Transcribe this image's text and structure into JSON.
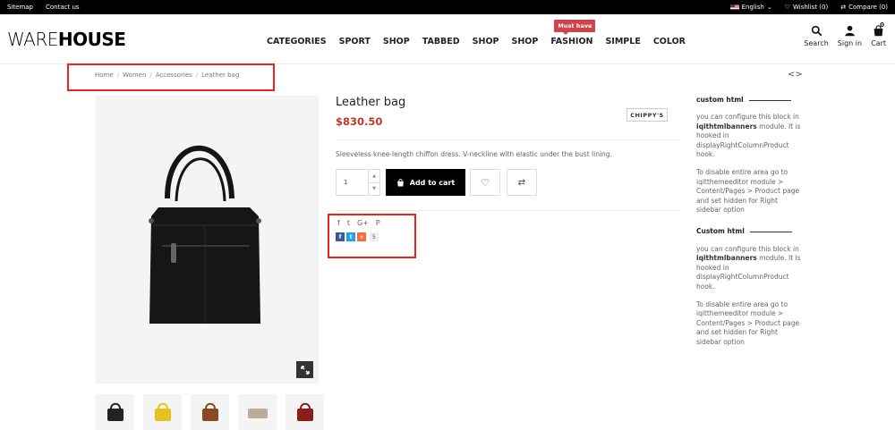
{
  "topbar": {
    "links": [
      "Sitemap",
      "Contact us"
    ],
    "language": "English",
    "wishlist": "Wishlist (0)",
    "compare": "Compare (0)"
  },
  "header": {
    "logo_light": "WARE",
    "logo_bold": "HOUSE",
    "nav": [
      "CATEGORIES",
      "SPORT",
      "SHOP",
      "TABBED",
      "SHOP",
      "SHOP",
      "FASHION",
      "SIMPLE",
      "COLOR"
    ],
    "nav_badge": "Must have",
    "search_label": "Search",
    "signin_label": "Sign in",
    "cart_label": "Cart",
    "cart_count": "0"
  },
  "breadcrumb": [
    "Home",
    "Women",
    "Accessories",
    "Leather bag"
  ],
  "pager": "<>",
  "product": {
    "name": "Leather bag",
    "price": "$830.50",
    "brand": "CHIPPY'S",
    "description": "Sleeveless knee-length chiffon dress. V-neckline with elastic under the bust lining.",
    "quantity": "1",
    "add_to_cart": "Add to cart",
    "share_count": "5"
  },
  "thumb_colors": [
    "#222222",
    "#e6c21c",
    "#8a4a1f",
    "#b8ad97",
    "#8d1d1d"
  ],
  "sidebar": [
    {
      "title": "custom html",
      "p1_a": "you can configure this block in ",
      "p1_b": "iqithtmlbanners",
      "p1_c": " module. It is hooked in displayRightColumnProduct hook.",
      "p2": "To disable entire area go to iqitthemeeditor module > Content/Pages > Product page and set hidden for Right sidebar option"
    },
    {
      "title": "Custom html",
      "p1_a": "you can configure this block in ",
      "p1_b": "iqithtmlbanners",
      "p1_c": " module. It is hooked in displayRightColumnProduct hook.",
      "p2": "To disable entire area go to iqitthemeeditor module > Content/Pages > Product page and set hidden for Right sidebar option"
    }
  ]
}
